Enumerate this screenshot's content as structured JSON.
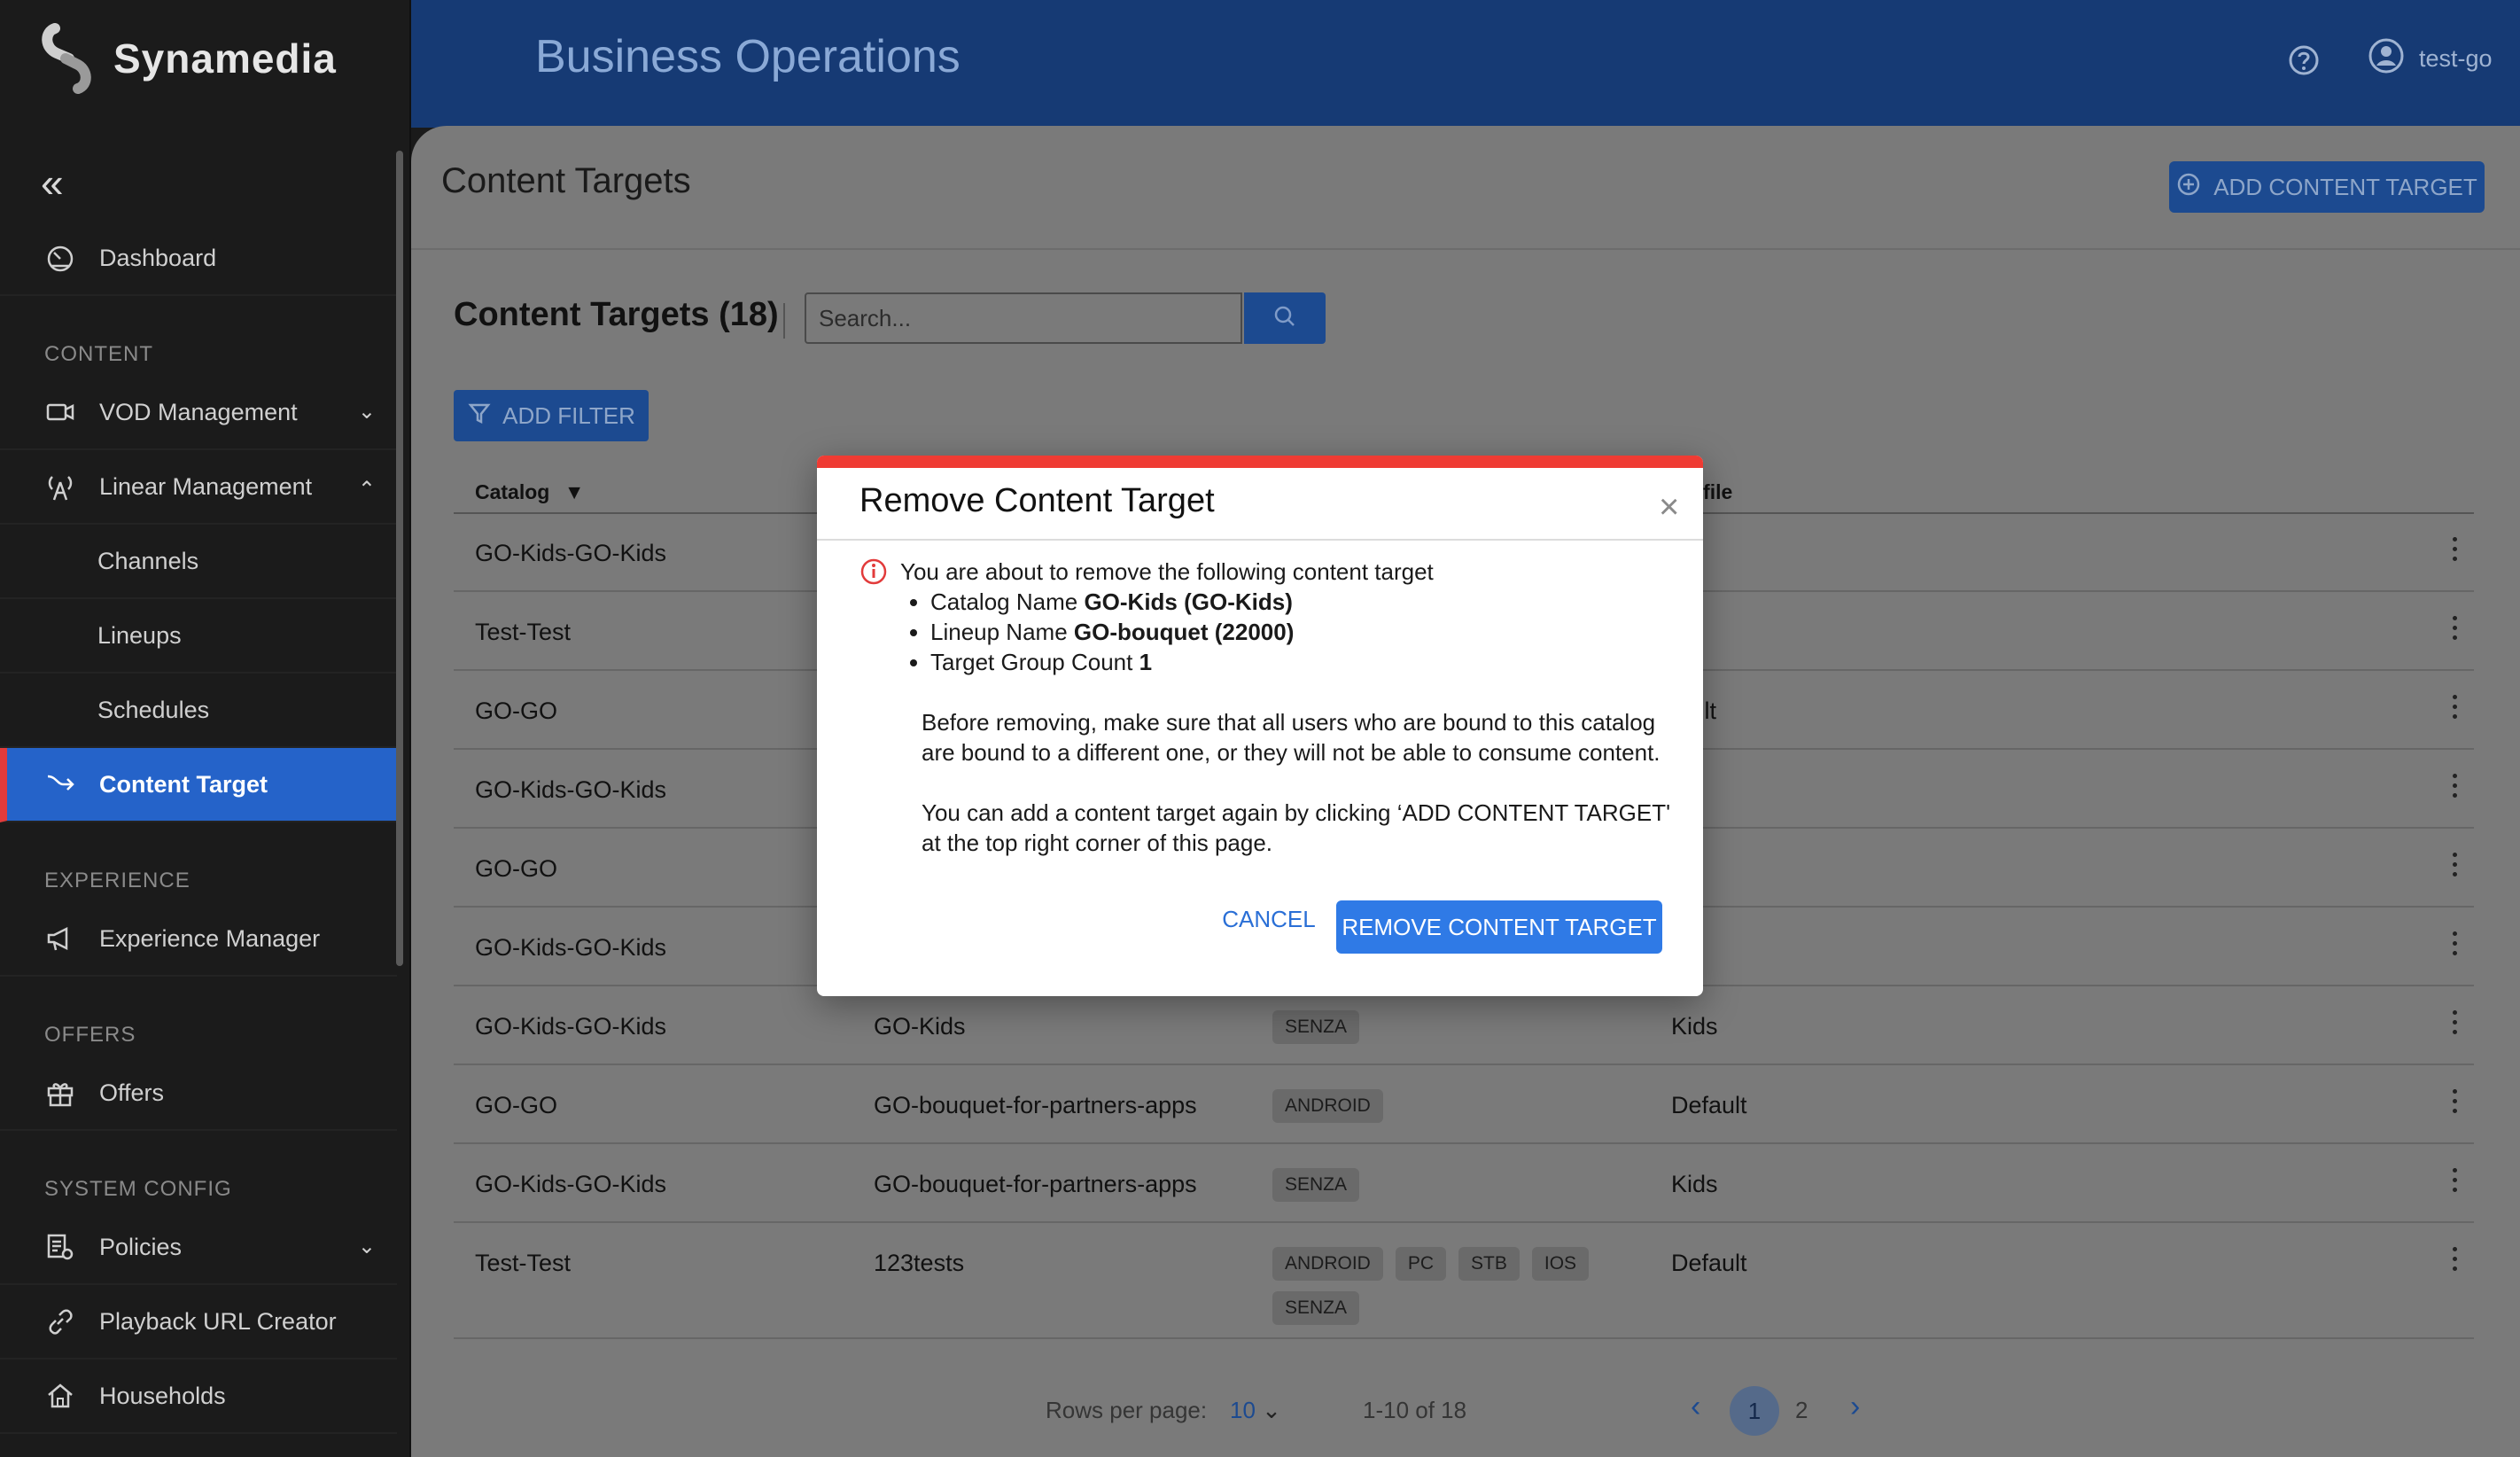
{
  "brand": {
    "name": "Synamedia"
  },
  "header": {
    "app_title": "Business Operations",
    "user_name": "test-go"
  },
  "sidebar": {
    "items": [
      {
        "label": "Dashboard"
      },
      {
        "label": "VOD Management"
      },
      {
        "label": "Linear Management"
      },
      {
        "label": "Channels"
      },
      {
        "label": "Lineups"
      },
      {
        "label": "Schedules"
      },
      {
        "label": "Content Target"
      },
      {
        "label": "Experience Manager"
      },
      {
        "label": "Offers"
      },
      {
        "label": "Policies"
      },
      {
        "label": "Playback URL Creator"
      },
      {
        "label": "Households"
      }
    ],
    "sections": [
      "CONTENT",
      "EXPERIENCE",
      "OFFERS",
      "SYSTEM CONFIG"
    ]
  },
  "page": {
    "title": "Content Targets",
    "add_button": "ADD CONTENT TARGET",
    "list_title": "Content Targets (18)",
    "search_placeholder": "Search...",
    "filter_button": "ADD FILTER"
  },
  "table": {
    "headers": {
      "catalog": "Catalog",
      "profile": "ofile"
    },
    "rows": [
      {
        "catalog": "GO-Kids-GO-Kids",
        "lineup": "",
        "devices": [],
        "profile": "s"
      },
      {
        "catalog": "Test-Test",
        "lineup": "",
        "devices": [],
        "profile": ""
      },
      {
        "catalog": "GO-GO",
        "lineup": "",
        "devices": [],
        "profile": "fault"
      },
      {
        "catalog": "GO-Kids-GO-Kids",
        "lineup": "",
        "devices": [],
        "profile": "s"
      },
      {
        "catalog": "GO-GO",
        "lineup": "",
        "devices": [],
        "profile": ""
      },
      {
        "catalog": "GO-Kids-GO-Kids",
        "lineup": "",
        "devices": [],
        "profile": "s"
      },
      {
        "catalog": "GO-Kids-GO-Kids",
        "lineup": "GO-Kids",
        "devices": [
          "SENZA"
        ],
        "profile": "Kids"
      },
      {
        "catalog": "GO-GO",
        "lineup": "GO-bouquet-for-partners-apps",
        "devices": [
          "ANDROID"
        ],
        "profile": "Default"
      },
      {
        "catalog": "GO-Kids-GO-Kids",
        "lineup": "GO-bouquet-for-partners-apps",
        "devices": [
          "SENZA"
        ],
        "profile": "Kids"
      },
      {
        "catalog": "Test-Test",
        "lineup": "123tests",
        "devices": [
          "ANDROID",
          "PC",
          "STB",
          "IOS",
          "SENZA"
        ],
        "profile": "Default"
      }
    ]
  },
  "pagination": {
    "rows_label": "Rows per page:",
    "rows_value": "10",
    "range": "1-10 of 18",
    "pages": [
      "1",
      "2"
    ],
    "current": "1"
  },
  "modal": {
    "title": "Remove Content Target",
    "intro": "You are about to remove the following content target",
    "catalog_label": "Catalog Name",
    "catalog_value": "GO-Kids (GO-Kids)",
    "lineup_label": "Lineup Name",
    "lineup_value": "GO-bouquet (22000)",
    "count_label": "Target Group Count",
    "count_value": "1",
    "para1": "Before removing, make sure that all users who are bound to this catalog are bound to a different one, or they will not be able to consume content.",
    "para2": "You can add a content target again by clicking ‘ADD CONTENT TARGET' at the top right corner of this page.",
    "cancel": "CANCEL",
    "confirm": "REMOVE CONTENT TARGET"
  },
  "colors": {
    "accent": "#2f7ae6",
    "danger": "#ef3b33",
    "sidebar_active": "#2563c9"
  }
}
